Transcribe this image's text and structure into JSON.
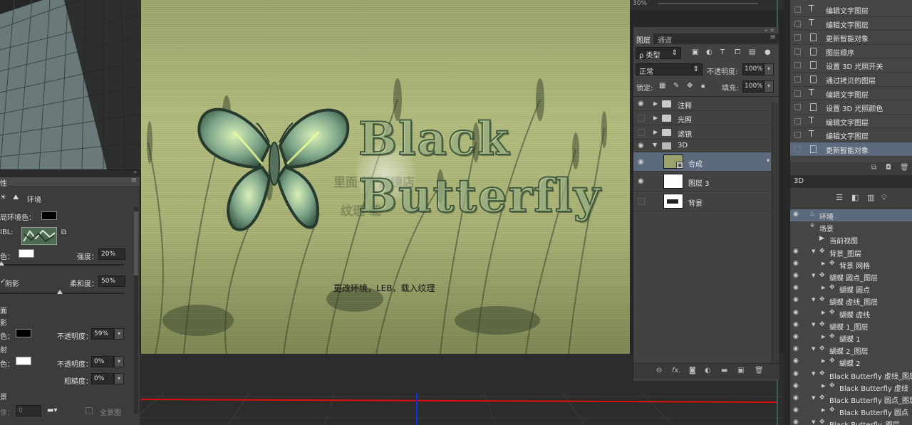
{
  "canvas": {
    "caption": "更改环境，LEB，载入纹理",
    "logo_line1": "Black",
    "logo_line2": "Butterfly",
    "faint_text_1": "里面 镜 滤镜店",
    "faint_text_2": "纹理 载"
  },
  "top_strip": {
    "label": "30%"
  },
  "properties": {
    "collapse_glyph": "«",
    "tab_fragment": "性",
    "menu_glyph": "≡",
    "env_tab_label": "环境",
    "global_ambient_label": "局环境色：",
    "global_ambient_color": "#000000",
    "ibl_label": "IBL:",
    "color_label": "色：",
    "color_value": "#ffffff",
    "intensity_label": "强度：",
    "intensity_value": "20%",
    "shadow_label": "阴影",
    "softness_label": "柔和度：",
    "softness_value": "50%",
    "ground_plane_label": "面",
    "ground_shadow_label": "影",
    "shadow_color_label": "色：",
    "shadow_color": "#000000",
    "shadow_opacity_label": "不透明度：",
    "shadow_opacity_value": "59%",
    "reflection_label": "射",
    "reflection_color_label": "色：",
    "reflection_color": "#ffffff",
    "reflection_opacity_label": "不透明度：",
    "reflection_opacity_value": "0%",
    "roughness_label": "粗糙度：",
    "roughness_value": "0%",
    "background_label": "景",
    "image_label": "像：",
    "image_value": "0",
    "panorama_label": "全景图"
  },
  "layers": {
    "collapse_glyph": "«",
    "close_glyph": "×",
    "menu_glyph": "≡",
    "tabs": [
      "图层",
      "通道"
    ],
    "filter_kind": "ρ 类型",
    "blend_mode": "正常",
    "opacity_label": "不透明度:",
    "opacity_value": "100%",
    "lock_label": "锁定:",
    "fill_label": "填充:",
    "fill_value": "100%",
    "items": [
      {
        "name": "注释",
        "type": "folder",
        "visible": true
      },
      {
        "name": "光照",
        "type": "folder",
        "visible": false
      },
      {
        "name": "滤镜",
        "type": "folder",
        "visible": false
      },
      {
        "name": "3D",
        "type": "folder-open",
        "visible": true
      },
      {
        "name": "合成",
        "type": "smart",
        "visible": true,
        "selected": true
      },
      {
        "name": "图层 3",
        "type": "white",
        "visible": true
      },
      {
        "name": "背景",
        "type": "bg",
        "visible": false
      }
    ]
  },
  "history": {
    "items": [
      {
        "label": "编辑文字图层",
        "icon": "T"
      },
      {
        "label": "编辑文字图层",
        "icon": "T"
      },
      {
        "label": "更新智能对象",
        "icon": "doc"
      },
      {
        "label": "图层顺序",
        "icon": "doc"
      },
      {
        "label": "设置 3D 光照开关",
        "icon": "doc"
      },
      {
        "label": "通过拷贝的图层",
        "icon": "doc"
      },
      {
        "label": "编辑文字图层",
        "icon": "T"
      },
      {
        "label": "设置 3D 光照颜色",
        "icon": "doc"
      },
      {
        "label": "编辑文字图层",
        "icon": "T"
      },
      {
        "label": "编辑文字图层",
        "icon": "T"
      },
      {
        "label": "更新智能对象",
        "icon": "doc",
        "selected": true
      }
    ]
  },
  "panel3d": {
    "tab_label": "3D",
    "items": [
      {
        "label": "环境",
        "level": 0,
        "icon": "env",
        "selected": true,
        "eye": true
      },
      {
        "label": "场景",
        "level": 0,
        "icon": "scene",
        "eye": false
      },
      {
        "label": "当前视图",
        "level": 1,
        "icon": "cam",
        "eye": false
      },
      {
        "label": "背景_图层",
        "level": 1,
        "icon": "mesh",
        "eye": true,
        "tri": "down"
      },
      {
        "label": "背景 网格",
        "level": 2,
        "icon": "mesh",
        "eye": true,
        "tri": "right"
      },
      {
        "label": "蝴蝶 圆点_图层",
        "level": 1,
        "icon": "mesh",
        "eye": true,
        "tri": "down"
      },
      {
        "label": "蝴蝶 圆点",
        "level": 2,
        "icon": "mesh",
        "eye": true,
        "tri": "right"
      },
      {
        "label": "蝴蝶 虚线_图层",
        "level": 1,
        "icon": "mesh",
        "eye": true,
        "tri": "down"
      },
      {
        "label": "蝴蝶 虚线",
        "level": 2,
        "icon": "mesh",
        "eye": true,
        "tri": "right"
      },
      {
        "label": "蝴蝶 1_图层",
        "level": 1,
        "icon": "mesh",
        "eye": true,
        "tri": "down"
      },
      {
        "label": "蝴蝶 1",
        "level": 2,
        "icon": "mesh",
        "eye": true,
        "tri": "right"
      },
      {
        "label": "蝴蝶 2_图层",
        "level": 1,
        "icon": "mesh",
        "eye": true,
        "tri": "down"
      },
      {
        "label": "蝴蝶 2",
        "level": 2,
        "icon": "mesh",
        "eye": true,
        "tri": "right"
      },
      {
        "label": "Black Butterfly 虚线_图层",
        "level": 1,
        "icon": "mesh",
        "eye": true,
        "tri": "down"
      },
      {
        "label": "Black Butterfly 虚线",
        "level": 2,
        "icon": "mesh",
        "eye": true,
        "tri": "right"
      },
      {
        "label": "Black Butterfly 圆点_图层",
        "level": 1,
        "icon": "mesh",
        "eye": true,
        "tri": "down"
      },
      {
        "label": "Black Butterfly 圆点",
        "level": 2,
        "icon": "mesh",
        "eye": true,
        "tri": "right"
      },
      {
        "label": "Black Butterfly_图层",
        "level": 1,
        "icon": "mesh",
        "eye": true,
        "tri": "down"
      }
    ]
  },
  "colors": {
    "selection": "#5b6a7c",
    "panel_bg": "#424242",
    "x_axis": "#e01010",
    "z_axis": "#1030e0"
  }
}
